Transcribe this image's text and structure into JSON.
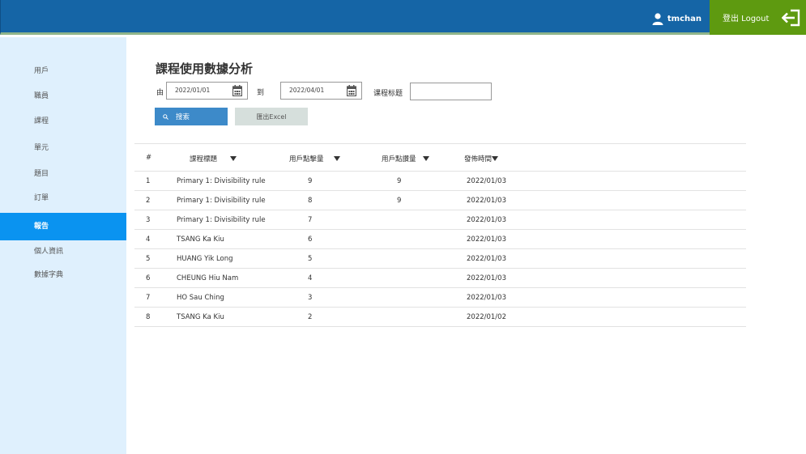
{
  "header": {
    "username": "tmchan",
    "logout_label": "登出 Logout"
  },
  "sidebar": {
    "items": [
      {
        "label": "用戶"
      },
      {
        "label": "職員"
      },
      {
        "label": "課程"
      },
      {
        "label": "單元"
      },
      {
        "label": "題目"
      },
      {
        "label": "訂單"
      },
      {
        "label": "報告",
        "active": true
      },
      {
        "label": "個人資訊"
      },
      {
        "label": "數據字典"
      }
    ]
  },
  "page": {
    "title": "課程使用數據分析",
    "from_label": "由",
    "from_date": "2022/01/01",
    "to_label": "到",
    "to_date": "2022/04/01",
    "course_title_label": "课程标题",
    "course_title_value": "",
    "search_label": "搜索",
    "export_label": "匯出Excel"
  },
  "table": {
    "columns": [
      "#",
      "課程標題",
      "用戶點擊量",
      "用戶點讚量",
      "發佈時間"
    ],
    "rows": [
      {
        "no": "1",
        "title": "Primary 1: Divisibility rule",
        "clicks": "9",
        "likes": "9",
        "date": "2022/01/03"
      },
      {
        "no": "2",
        "title": "Primary 1: Divisibility rule",
        "clicks": "8",
        "likes": "9",
        "date": "2022/01/03"
      },
      {
        "no": "3",
        "title": "Primary 1: Divisibility rule",
        "clicks": "7",
        "likes": "",
        "date": "2022/01/03"
      },
      {
        "no": "4",
        "title": "TSANG Ka Kiu",
        "clicks": "6",
        "likes": "",
        "date": "2022/01/03"
      },
      {
        "no": "5",
        "title": "HUANG Yik Long",
        "clicks": "5",
        "likes": "",
        "date": "2022/01/03"
      },
      {
        "no": "6",
        "title": "CHEUNG Hiu Nam",
        "clicks": "4",
        "likes": "",
        "date": "2022/01/03"
      },
      {
        "no": "7",
        "title": "HO Sau Ching",
        "clicks": "3",
        "likes": "",
        "date": "2022/01/03"
      },
      {
        "no": "8",
        "title": "TSANG Ka Kiu",
        "clicks": "2",
        "likes": "",
        "date": "2022/01/02"
      }
    ]
  }
}
